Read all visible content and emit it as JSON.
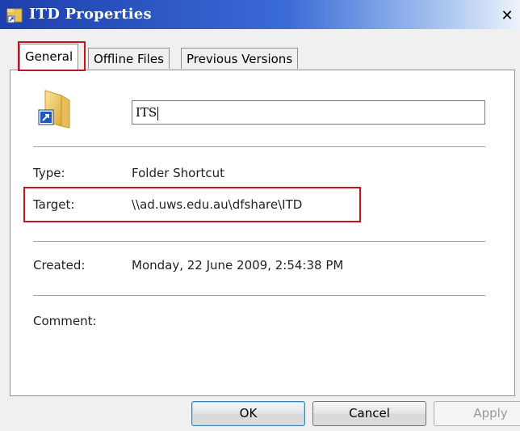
{
  "window": {
    "title": "ITD Properties",
    "close_glyph": "✕"
  },
  "tabs": [
    {
      "label": "General",
      "active": true
    },
    {
      "label": "Offline Files",
      "active": false
    },
    {
      "label": "Previous Versions",
      "active": false
    }
  ],
  "general": {
    "name_value": "ITS",
    "icon": "folder-shortcut-icon",
    "fields": {
      "type_label": "Type:",
      "type_value": "Folder Shortcut",
      "target_label": "Target:",
      "target_value": "\\\\ad.uws.edu.au\\dfshare\\ITD",
      "created_label": "Created:",
      "created_value": "Monday, 22 June 2009, 2:54:38 PM",
      "comment_label": "Comment:"
    }
  },
  "buttons": {
    "ok": "OK",
    "cancel": "Cancel",
    "apply": "Apply"
  },
  "colors": {
    "highlight": "#c0161d",
    "titlebar": "#1e3fae"
  }
}
